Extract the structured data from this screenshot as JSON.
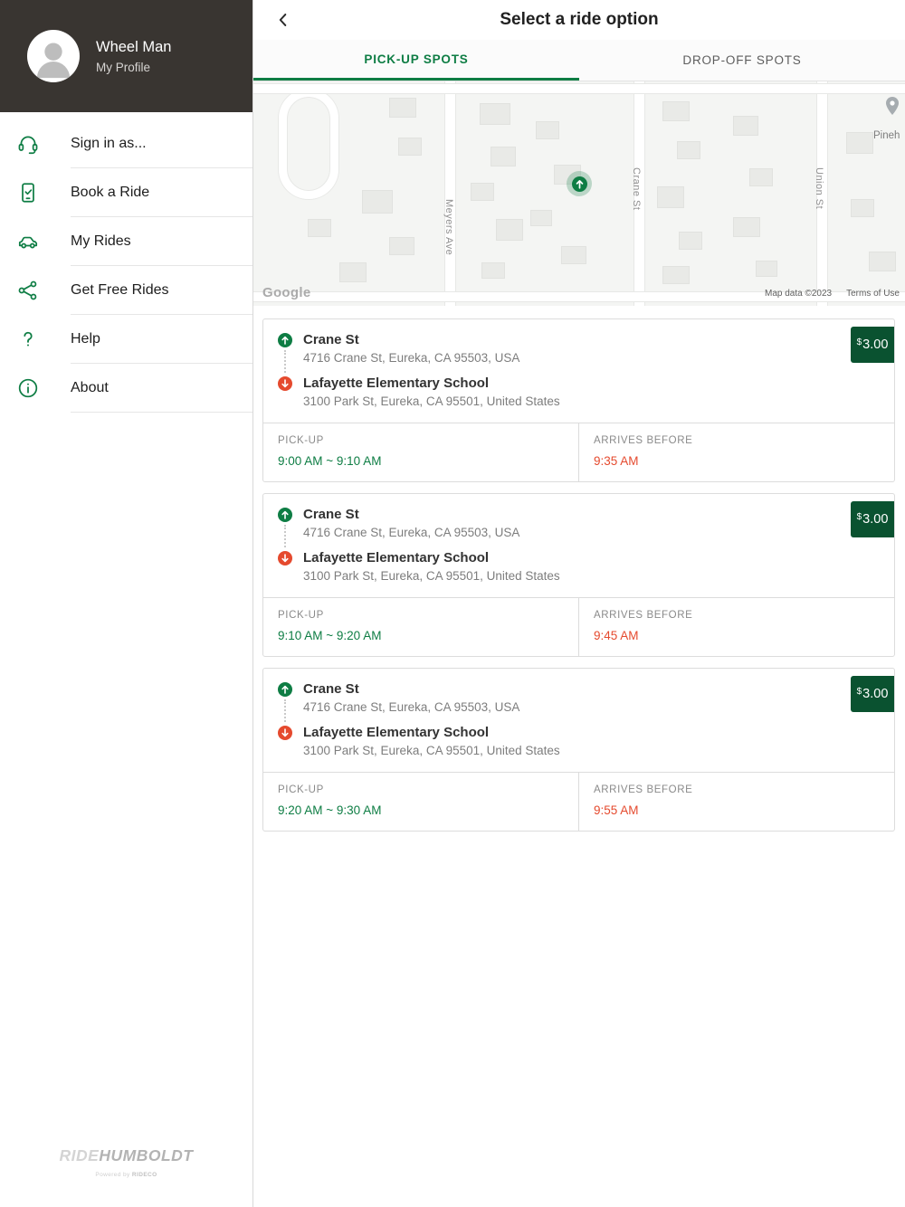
{
  "sidebar": {
    "profile": {
      "name": "Wheel Man",
      "subtitle": "My Profile"
    },
    "items": [
      {
        "label": "Sign in as...",
        "icon": "headset-icon"
      },
      {
        "label": "Book a Ride",
        "icon": "booking-check-icon"
      },
      {
        "label": "My Rides",
        "icon": "car-icon"
      },
      {
        "label": "Get Free Rides",
        "icon": "share-icon"
      },
      {
        "label": "Help",
        "icon": "question-icon"
      },
      {
        "label": "About",
        "icon": "info-icon"
      }
    ],
    "brand": {
      "light": "RIDE",
      "bold": "HUMBOLDT",
      "powered_by": "Powered by",
      "powered_brand": "RIDECO"
    }
  },
  "header": {
    "title": "Select a ride option"
  },
  "tabs": {
    "pickup": "PICK-UP SPOTS",
    "dropoff": "DROP-OFF SPOTS"
  },
  "map": {
    "streets": [
      "Meyers Ave",
      "Crane St",
      "Union St"
    ],
    "poi_label": "Pineh",
    "google": "Google",
    "map_data": "Map data ©2023",
    "terms": "Terms of Use"
  },
  "labels": {
    "pickup": "PICK-UP",
    "arrives_before": "ARRIVES BEFORE"
  },
  "rides": [
    {
      "pickup_name": "Crane St",
      "pickup_address": "4716 Crane St, Eureka, CA 95503, USA",
      "dropoff_name": "Lafayette Elementary School",
      "dropoff_address": "3100 Park St, Eureka, CA 95501, United States",
      "currency": "$",
      "price": "3.00",
      "pickup_window": "9:00 AM ~ 9:10 AM",
      "arrives": "9:35 AM"
    },
    {
      "pickup_name": "Crane St",
      "pickup_address": "4716 Crane St, Eureka, CA 95503, USA",
      "dropoff_name": "Lafayette Elementary School",
      "dropoff_address": "3100 Park St, Eureka, CA 95501, United States",
      "currency": "$",
      "price": "3.00",
      "pickup_window": "9:10 AM ~ 9:20 AM",
      "arrives": "9:45 AM"
    },
    {
      "pickup_name": "Crane St",
      "pickup_address": "4716 Crane St, Eureka, CA 95503, USA",
      "dropoff_name": "Lafayette Elementary School",
      "dropoff_address": "3100 Park St, Eureka, CA 95501, United States",
      "currency": "$",
      "price": "3.00",
      "pickup_window": "9:20 AM ~ 9:30 AM",
      "arrives": "9:55 AM"
    }
  ],
  "colors": {
    "accent_green": "#0e7d44",
    "badge_green": "#0a5230",
    "alert_red": "#e54a2e",
    "sidebar_header": "#393531"
  }
}
